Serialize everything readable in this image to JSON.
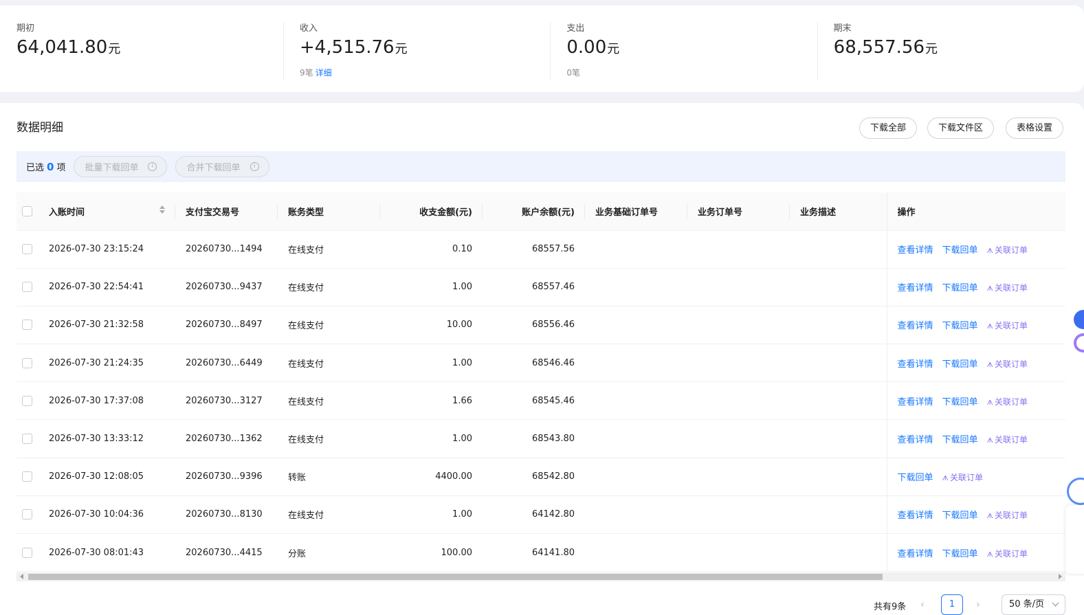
{
  "summary": {
    "opening": {
      "label": "期初",
      "value": "64,041.80",
      "unit": "元"
    },
    "income": {
      "label": "收入",
      "value": "+4,515.76",
      "unit": "元",
      "count": "9笔",
      "detail_link": "详细"
    },
    "expense": {
      "label": "支出",
      "value": "0.00",
      "unit": "元",
      "count": "0笔"
    },
    "closing": {
      "label": "期末",
      "value": "68,557.56",
      "unit": "元"
    }
  },
  "details": {
    "title": "数据明细",
    "download_all": "下载全部",
    "download_files": "下载文件区",
    "table_settings": "表格设置"
  },
  "selection": {
    "prefix": "已选",
    "count": "0",
    "suffix": "项",
    "batch_download": "批量下载回单",
    "merge_download": "合并下载回单"
  },
  "table": {
    "columns": [
      "入账时间",
      "支付宝交易号",
      "账务类型",
      "收支金额(元)",
      "账户余额(元)",
      "业务基础订单号",
      "业务订单号",
      "业务描述",
      "操作"
    ],
    "actions": {
      "view": "查看详情",
      "download": "下载回单",
      "link_order": "关联订单"
    },
    "rows": [
      {
        "time": "2026-07-30 23:15:24",
        "txn": "20260730...1494",
        "type": "在线支付",
        "amount": "0.10",
        "balance": "68557.56",
        "base_order": "",
        "order": "",
        "desc": "",
        "has_view": true
      },
      {
        "time": "2026-07-30 22:54:41",
        "txn": "20260730...9437",
        "type": "在线支付",
        "amount": "1.00",
        "balance": "68557.46",
        "base_order": "",
        "order": "",
        "desc": "",
        "has_view": true
      },
      {
        "time": "2026-07-30 21:32:58",
        "txn": "20260730...8497",
        "type": "在线支付",
        "amount": "10.00",
        "balance": "68556.46",
        "base_order": "",
        "order": "",
        "desc": "",
        "has_view": true
      },
      {
        "time": "2026-07-30 21:24:35",
        "txn": "20260730...6449",
        "type": "在线支付",
        "amount": "1.00",
        "balance": "68546.46",
        "base_order": "",
        "order": "",
        "desc": "",
        "has_view": true
      },
      {
        "time": "2026-07-30 17:37:08",
        "txn": "20260730...3127",
        "type": "在线支付",
        "amount": "1.66",
        "balance": "68545.46",
        "base_order": "",
        "order": "",
        "desc": "",
        "has_view": true
      },
      {
        "time": "2026-07-30 13:33:12",
        "txn": "20260730...1362",
        "type": "在线支付",
        "amount": "1.00",
        "balance": "68543.80",
        "base_order": "",
        "order": "",
        "desc": "",
        "has_view": true
      },
      {
        "time": "2026-07-30 12:08:05",
        "txn": "20260730...9396",
        "type": "转账",
        "amount": "4400.00",
        "balance": "68542.80",
        "base_order": "",
        "order": "",
        "desc": "",
        "has_view": false
      },
      {
        "time": "2026-07-30 10:04:36",
        "txn": "20260730...8130",
        "type": "在线支付",
        "amount": "1.00",
        "balance": "64142.80",
        "base_order": "",
        "order": "",
        "desc": "",
        "has_view": true
      },
      {
        "time": "2026-07-30 08:01:43",
        "txn": "20260730...4415",
        "type": "分账",
        "amount": "100.00",
        "balance": "64141.80",
        "base_order": "",
        "order": "",
        "desc": "",
        "has_view": true
      }
    ]
  },
  "pagination": {
    "total": "共有9条",
    "current_page": "1",
    "page_size": "50 条/页"
  },
  "icons": {
    "sort": "sort-icon",
    "info": "info-icon",
    "ai": "ai-icon",
    "prev": "chevron-left-icon",
    "next": "chevron-right-icon"
  },
  "colors": {
    "accent": "#1677ff",
    "ai": "#8a6ff0",
    "selection_bar": "#eef3fd"
  }
}
